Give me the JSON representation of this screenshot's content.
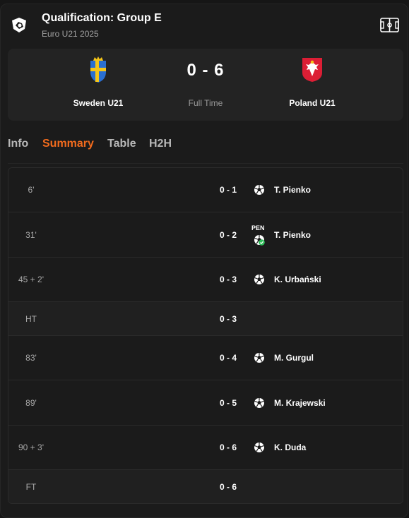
{
  "header": {
    "title": "Qualification: Group E",
    "subtitle": "Euro U21 2025"
  },
  "match": {
    "home_team": "Sweden U21",
    "away_team": "Poland U21",
    "score": "0 - 6",
    "status": "Full Time"
  },
  "tabs": [
    {
      "label": "Info",
      "active": false
    },
    {
      "label": "Summary",
      "active": true
    },
    {
      "label": "Table",
      "active": false
    },
    {
      "label": "H2H",
      "active": false
    }
  ],
  "events": [
    {
      "minute": "6'",
      "score": "0 - 1",
      "player": "T. Pienko",
      "type": "goal",
      "badge": ""
    },
    {
      "minute": "31'",
      "score": "0 - 2",
      "player": "T. Pienko",
      "type": "penalty",
      "badge": "PEN"
    },
    {
      "minute": "45 + 2'",
      "score": "0 - 3",
      "player": "K. Urbański",
      "type": "goal",
      "badge": ""
    },
    {
      "minute": "HT",
      "score": "0 - 3",
      "player": "",
      "type": "period",
      "badge": ""
    },
    {
      "minute": "83'",
      "score": "0 - 4",
      "player": "M. Gurgul",
      "type": "goal",
      "badge": ""
    },
    {
      "minute": "89'",
      "score": "0 - 5",
      "player": "M. Krajewski",
      "type": "goal",
      "badge": ""
    },
    {
      "minute": "90 + 3'",
      "score": "0 - 6",
      "player": "K. Duda",
      "type": "goal",
      "badge": ""
    },
    {
      "minute": "FT",
      "score": "0 - 6",
      "player": "",
      "type": "period",
      "badge": ""
    }
  ],
  "colors": {
    "accent": "#f26b1d",
    "background": "#1b1b1b",
    "panel": "#232323",
    "penalty_check": "#2ebd59"
  },
  "icons": {
    "league": "league-logo-icon",
    "pitch": "pitch-view-icon",
    "goal": "football-icon",
    "penalty_scored": "penalty-scored-icon"
  }
}
